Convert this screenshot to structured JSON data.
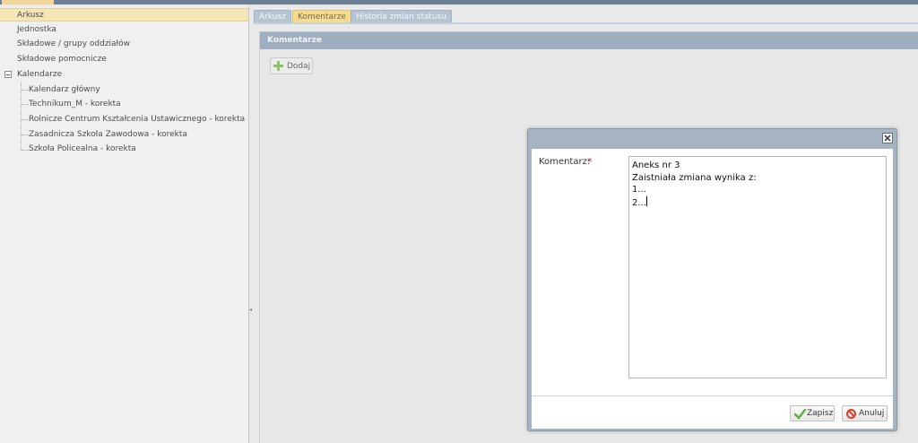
{
  "top_bar": {
    "tab_stub_label": ""
  },
  "tree": {
    "items": [
      {
        "label": "Arkusz",
        "level": 0,
        "selected": true
      },
      {
        "label": "Jednostka",
        "level": 0
      },
      {
        "label": "Składowe / grupy oddziałów",
        "level": 0
      },
      {
        "label": "Składowe pomocnicze",
        "level": 0
      },
      {
        "label": "Kalendarze",
        "level": 0,
        "expanded": true
      },
      {
        "label": "Kalendarz główny",
        "level": 1
      },
      {
        "label": "Technikum_M - korekta",
        "level": 1
      },
      {
        "label": "Rolnicze Centrum Kształcenia Ustawicznego - korekta",
        "level": 1
      },
      {
        "label": "Zasadnicza Szkoła Zawodowa - korekta",
        "level": 1
      },
      {
        "label": "Szkoła Policealna - korekta",
        "level": 1
      }
    ]
  },
  "tabs": [
    {
      "label": "Arkusz",
      "active": false
    },
    {
      "label": "Komentarze",
      "active": true
    },
    {
      "label": "Historia zmian statusu",
      "active": false
    }
  ],
  "panel": {
    "title": "Komentarze",
    "add_button": "Dodaj"
  },
  "dialog": {
    "field_label": "Komentarz:",
    "required_mark": "*",
    "comment_lines": [
      "Aneks nr 3",
      "Zaistniała zmiana wynika z:",
      "1...",
      "2..."
    ],
    "save_button": "Zapisz",
    "cancel_button": "Anuluj"
  },
  "colors": {
    "accent_tab": "#f6dc8a",
    "header": "#9eaebf",
    "required": "#d21f1f"
  }
}
